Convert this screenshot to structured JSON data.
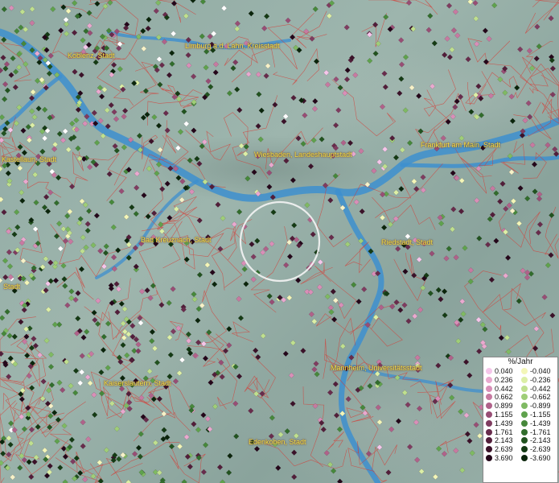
{
  "map": {
    "place_labels": [
      {
        "id": "koblenz",
        "text": "Koblenz, Stadt"
      },
      {
        "id": "limburg",
        "text": "Limburg a.d. Lahn, Kreisstadt"
      },
      {
        "id": "kastellaun",
        "text": "Kastellaun, Stadt"
      },
      {
        "id": "wiesbaden",
        "text": "Wiesbaden, Landeshauptstadt"
      },
      {
        "id": "frankfurt",
        "text": "Frankfurt am Main, Stadt"
      },
      {
        "id": "bad-kreuznach",
        "text": "Bad Kreuznach, Stadt"
      },
      {
        "id": "riedstadt",
        "text": "Riedstadt, Stadt"
      },
      {
        "id": "stadt-west",
        "text": "Stadt"
      },
      {
        "id": "mannheim",
        "text": "Mannheim, Universitätsstadt"
      },
      {
        "id": "kaiserslautern",
        "text": "Kaiserslautern, Stadt"
      },
      {
        "id": "edenkoben",
        "text": "Edenkoben, Stadt"
      }
    ]
  },
  "legend": {
    "title": "%/Jahr",
    "positive": [
      {
        "value": "0.040",
        "color": "#f5c6ea"
      },
      {
        "value": "0.236",
        "color": "#e9a9cf"
      },
      {
        "value": "0.442",
        "color": "#d98fb8"
      },
      {
        "value": "0.662",
        "color": "#c77aa1"
      },
      {
        "value": "0.899",
        "color": "#b0628a"
      },
      {
        "value": "1.155",
        "color": "#984e75"
      },
      {
        "value": "1.439",
        "color": "#7f3c60"
      },
      {
        "value": "1.761",
        "color": "#682c4c"
      },
      {
        "value": "2.143",
        "color": "#521e3a"
      },
      {
        "value": "2.639",
        "color": "#3b1229"
      },
      {
        "value": "3.690",
        "color": "#24071a"
      }
    ],
    "negative": [
      {
        "value": "-0.040",
        "color": "#f3f6b8"
      },
      {
        "value": "-0.236",
        "color": "#dcefa6"
      },
      {
        "value": "-0.442",
        "color": "#bfe08f"
      },
      {
        "value": "-0.662",
        "color": "#9fce78"
      },
      {
        "value": "-0.899",
        "color": "#7fba63"
      },
      {
        "value": "-1.155",
        "color": "#5fa24d"
      },
      {
        "value": "-1.439",
        "color": "#46883b"
      },
      {
        "value": "-1.761",
        "color": "#316d2c"
      },
      {
        "value": "-2.143",
        "color": "#21531f"
      },
      {
        "value": "-2.639",
        "color": "#143b14"
      },
      {
        "value": "-3.690",
        "color": "#0a250b"
      }
    ]
  },
  "colors": {
    "river": "#3d8fcf",
    "boundaries": "#d9362f",
    "label_text": "#f0e24a",
    "selection_ring": "#f4f4f4"
  }
}
